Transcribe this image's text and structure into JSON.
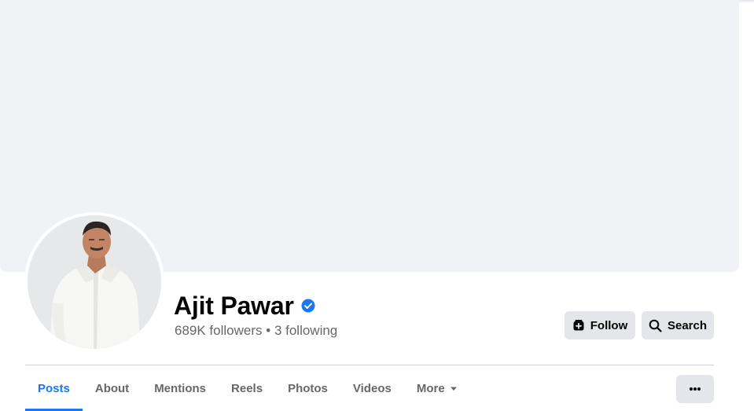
{
  "profile": {
    "name": "Ajit Pawar",
    "verified": true,
    "followers": "689K followers",
    "separator": "•",
    "following": "3 following"
  },
  "actions": {
    "follow_label": "Follow",
    "search_label": "Search"
  },
  "tabs": [
    {
      "label": "Posts",
      "active": true
    },
    {
      "label": "About"
    },
    {
      "label": "Mentions"
    },
    {
      "label": "Reels"
    },
    {
      "label": "Photos"
    },
    {
      "label": "Videos"
    },
    {
      "label": "More",
      "has_caret": true
    }
  ],
  "colors": {
    "accent": "#1877f2",
    "cover": "#f0f2f5",
    "button_bg": "#e4e6eb",
    "secondary_text": "#65676b"
  },
  "icons": {
    "verified": "verified-badge-icon",
    "follow": "follow-add-icon",
    "search": "search-icon",
    "more_caret": "caret-down-icon",
    "overflow": "ellipsis-icon"
  }
}
